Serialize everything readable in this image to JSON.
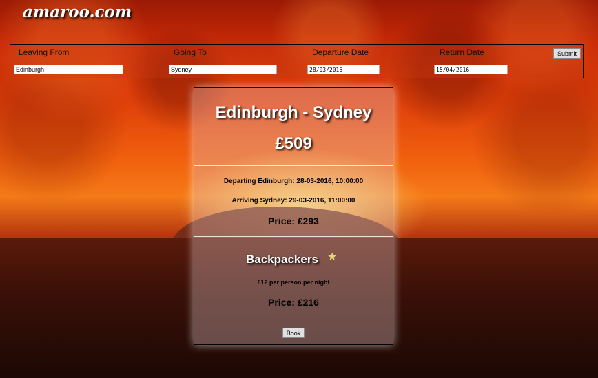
{
  "brand": {
    "logo": "amaroo.com"
  },
  "search": {
    "leaving_from_label": "Leaving From",
    "leaving_from_value": "Edinburgh",
    "going_to_label": "Going To",
    "going_to_value": "Sydney",
    "departure_label": "Departure Date",
    "departure_value": "28/03/2016",
    "return_label": "Return Date",
    "return_value": "15/04/2016",
    "submit_label": "Submit"
  },
  "result": {
    "route": "Edinburgh - Sydney",
    "total_price": "£509",
    "flight": {
      "departing": "Departing Edinburgh: 28-03-2016, 10:00:00",
      "arriving": "Arriving Sydney: 29-03-2016, 11:00:00",
      "price": "Price: £293"
    },
    "accommodation": {
      "name": "Backpackers",
      "rating_icon": "star-icon",
      "rate": "£12 per person per night",
      "price": "Price: £216"
    },
    "book_label": "Book"
  }
}
